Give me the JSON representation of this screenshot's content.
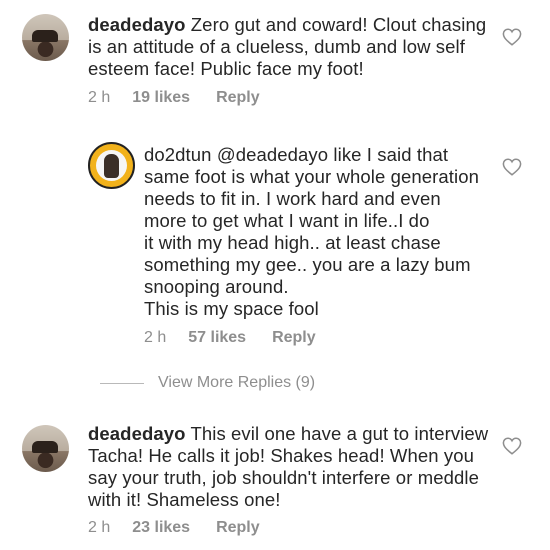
{
  "comments": [
    {
      "username": "deadedayo",
      "lines": [
        " Zero gut and coward! Clout chasing",
        "is an attitude of a clueless, dumb and low self",
        "esteem face!  Public face my foot!"
      ],
      "time": "2 h",
      "likes": "19 likes",
      "reply": "Reply"
    },
    {
      "username": "do2dtun",
      "lines": [
        " @deadedayo like I said that",
        "same foot is what your whole generation",
        "needs to fit in. I work hard and even",
        "more to get what I want in life..I do",
        "it with my head high.. at least chase",
        "something my gee.. you are a lazy bum",
        "snooping around.",
        "This is my space fool"
      ],
      "time": "2 h",
      "likes": "57 likes",
      "reply": "Reply"
    },
    {
      "username": "deadedayo",
      "lines": [
        " This evil one have a gut to interview",
        "Tacha! He calls it job! Shakes head! When you",
        "say your truth, job shouldn't interfere or meddle",
        "with it! Shameless one!"
      ],
      "time": "2 h",
      "likes": "23 likes",
      "reply": "Reply"
    }
  ],
  "view_more": "View More Replies (9)",
  "icons": {
    "like": "heart-outline-icon"
  },
  "colors": {
    "text": "#262626",
    "meta": "#8e8e8e"
  }
}
